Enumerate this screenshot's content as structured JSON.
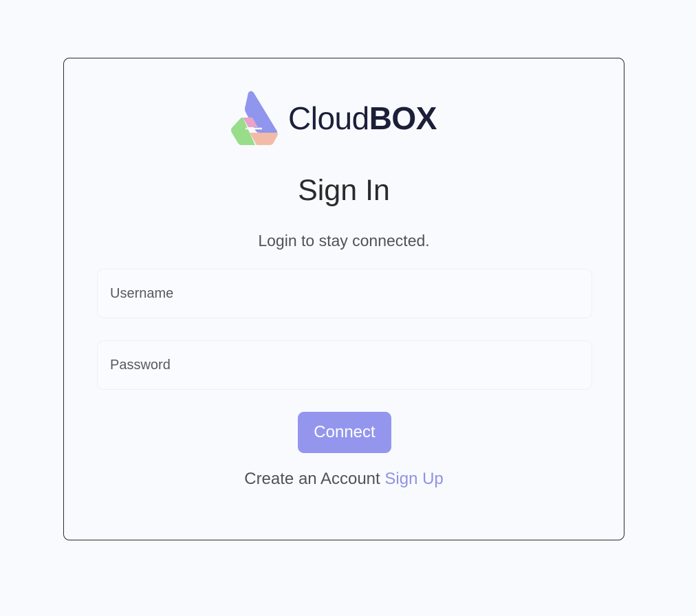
{
  "logo": {
    "brand_light": "Cloud",
    "brand_bold": "BOX",
    "colors": {
      "purple": "#9095ee",
      "pink": "#e9a4c8",
      "green": "#98dd8a",
      "peach": "#f2bba7"
    }
  },
  "form": {
    "title": "Sign In",
    "subtitle": "Login to stay connected.",
    "username_placeholder": "Username",
    "password_placeholder": "Password",
    "submit_label": "Connect",
    "account_prompt": "Create an Account",
    "signup_link": "Sign Up"
  },
  "colors": {
    "accent": "#9496ee",
    "link": "#8f92e4",
    "background": "#f9fafe"
  }
}
